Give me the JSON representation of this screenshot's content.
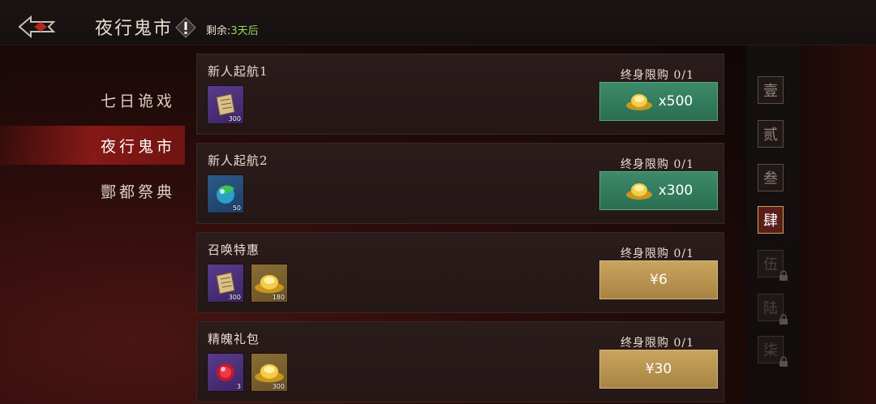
{
  "header": {
    "title": "夜行鬼市",
    "remain_label": "剩余:",
    "remain_value": "3天后"
  },
  "sidebar": {
    "items": [
      {
        "label": "七日诡戏"
      },
      {
        "label": "夜行鬼市"
      },
      {
        "label": "酆都祭典"
      }
    ],
    "active_index": 1
  },
  "cards": [
    {
      "title": "新人起航1",
      "limit": "终身限购 0/1",
      "items": [
        {
          "type": "scroll-icon",
          "qty": "300",
          "color": "purple"
        }
      ],
      "button": {
        "style": "green",
        "icon": "gold-ingot-icon",
        "label": "x500"
      }
    },
    {
      "title": "新人起航2",
      "limit": "终身限购 0/1",
      "items": [
        {
          "type": "jade-orb-icon",
          "qty": "50",
          "color": "blue"
        }
      ],
      "button": {
        "style": "green",
        "icon": "gold-ingot-icon",
        "label": "x300"
      }
    },
    {
      "title": "召唤特惠",
      "limit": "终身限购 0/1",
      "items": [
        {
          "type": "scroll-icon",
          "qty": "300",
          "color": "purple"
        },
        {
          "type": "gold-ingot-icon",
          "qty": "180",
          "color": "gold"
        }
      ],
      "button": {
        "style": "tan",
        "label": "¥6"
      }
    },
    {
      "title": "精魄礼包",
      "limit": "终身限购 0/1",
      "items": [
        {
          "type": "red-orb-icon",
          "qty": "3",
          "color": "purple"
        },
        {
          "type": "gold-ingot-icon",
          "qty": "300",
          "color": "gold"
        }
      ],
      "button": {
        "style": "tan",
        "label": "¥30"
      }
    }
  ],
  "page_tabs": [
    {
      "label": "壹",
      "locked": false
    },
    {
      "label": "贰",
      "locked": false
    },
    {
      "label": "叁",
      "locked": false
    },
    {
      "label": "肆",
      "locked": false,
      "active": true
    },
    {
      "label": "伍",
      "locked": true
    },
    {
      "label": "陆",
      "locked": true
    },
    {
      "label": "柒",
      "locked": true
    }
  ],
  "colors": {
    "accent_red": "#96201a",
    "green_button": "#2b6e52",
    "tan_button": "#a88443",
    "remain_green": "#8fdc5a"
  }
}
